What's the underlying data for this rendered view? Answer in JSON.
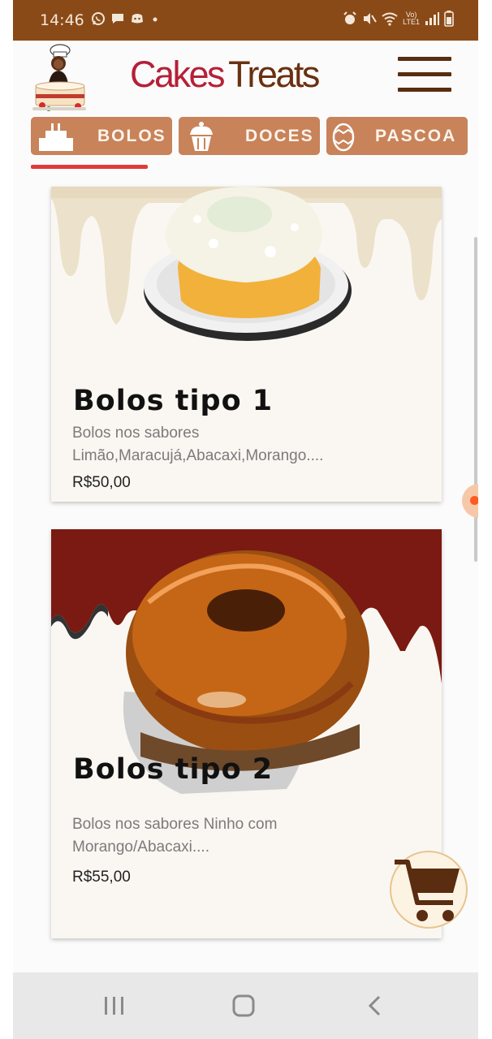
{
  "status_bar": {
    "time": "14:46",
    "left_icons": [
      "whatsapp-icon",
      "message-icon",
      "discord-icon",
      "dot-icon"
    ],
    "right_icons": [
      "alarm-icon",
      "mute-icon",
      "wifi-icon",
      "volte-icon",
      "signal-icon",
      "battery-icon"
    ],
    "volte_label": "Vo)\nLTE1"
  },
  "header": {
    "brand_word1": "Cakes",
    "brand_word2": "Treats",
    "logo_icon": "baker-cake-logo",
    "menu_icon": "hamburger-icon"
  },
  "tabs": [
    {
      "label": "BOLOS",
      "icon": "cake-icon",
      "active": true
    },
    {
      "label": "DOCES",
      "icon": "cupcake-icon",
      "active": false
    },
    {
      "label": "PASCOA",
      "icon": "easter-egg-icon",
      "active": false
    }
  ],
  "products": [
    {
      "title": "Bolos tipo 1",
      "description": "Bolos nos sabores Limão,Maracujá,Abacaxi,Morango....",
      "price": "R$50,00",
      "image": "coconut-cake-photo"
    },
    {
      "title": "Bolos tipo 2",
      "description": "Bolos nos sabores Ninho com Morango/Abacaxi....",
      "price": "R$55,00",
      "image": "chocolate-cake-photo"
    }
  ],
  "cart_button": {
    "icon": "cart-icon"
  },
  "nav_bar": {
    "icons": [
      "recent-apps-icon",
      "home-icon",
      "back-icon"
    ]
  },
  "colors": {
    "status_bar": "#8a4a17",
    "tab_bg": "#c8835a",
    "brand_red": "#b52038",
    "brand_brown": "#6a3010",
    "tab_indicator": "#e03a3a"
  }
}
